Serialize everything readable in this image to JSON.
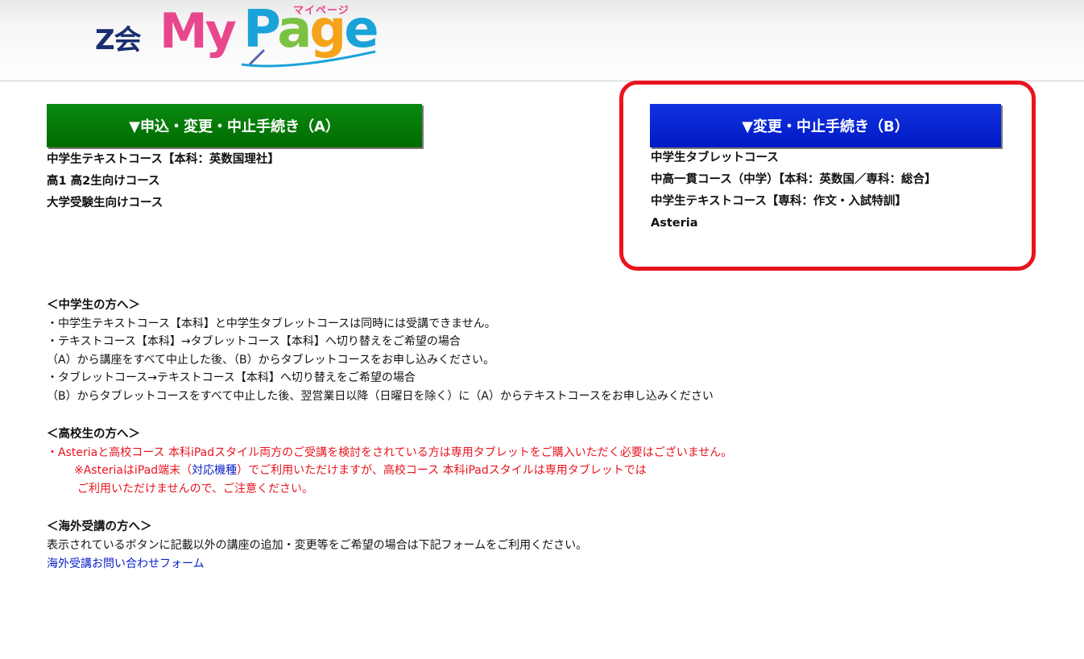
{
  "header": {
    "logo_brand": "Z会",
    "logo_my": "My",
    "logo_page_p": "P",
    "logo_page_a": "a",
    "logo_page_g": "g",
    "logo_page_e": "e",
    "logo_kana": "マイページ",
    "colors": {
      "brand": "#1a2e6e",
      "pink": "#e8478d",
      "blue": "#1aa3d9",
      "green": "#7cc242",
      "orange": "#f5a31a"
    }
  },
  "button_a": {
    "label": "▼申込・変更・中止手続き（A）",
    "color": "#0a8a10",
    "courses": [
      "中学生テキストコース【本科：英数国理社】",
      "高1 高2生向けコース",
      "大学受験生向けコース"
    ]
  },
  "button_b": {
    "label": "▼変更・中止手続き（B）",
    "color": "#0019c4",
    "courses": [
      "中学生タブレットコース",
      "中高一貫コース（中学）【本科：英数国／専科：総合】",
      "中学生テキストコース【専科：作文・入試特訓】",
      "Asteria"
    ]
  },
  "highlight_color": "#e8141e",
  "notes": {
    "junior_high": {
      "title": "＜中学生の方へ＞",
      "lines": [
        "・中学生テキストコース【本科】と中学生タブレットコースは同時には受講できません。",
        "・テキストコース【本科】→タブレットコース【本科】へ切り替えをご希望の場合",
        "（A）から講座をすべて中止した後、（B）からタブレットコースをお申し込みください。",
        "・タブレットコース→テキストコース【本科】へ切り替えをご希望の場合",
        "（B）からタブレットコースをすべて中止した後、翌営業日以降（日曜日を除く）に（A）からテキストコースをお申し込みください"
      ]
    },
    "high_school": {
      "title": "＜高校生の方へ＞",
      "line1": "・Asteriaと高校コース 本科iPadスタイル両方のご受講を検討をされている方は専用タブレットをご購入いただく必要はございません。",
      "line2_pre": "※AsteriaはiPad端末（",
      "line2_link": "対応機種",
      "line2_post": "）でご利用いただけますが、高校コース 本科iPadスタイルは専用タブレットでは",
      "line3": "ご利用いただけませんので、ご注意ください。"
    },
    "overseas": {
      "title": "＜海外受講の方へ＞",
      "line1": "表示されているボタンに記載以外の講座の追加・変更等をご希望の場合は下記フォームをご利用ください。",
      "link": "海外受講お問い合わせフォーム"
    }
  }
}
